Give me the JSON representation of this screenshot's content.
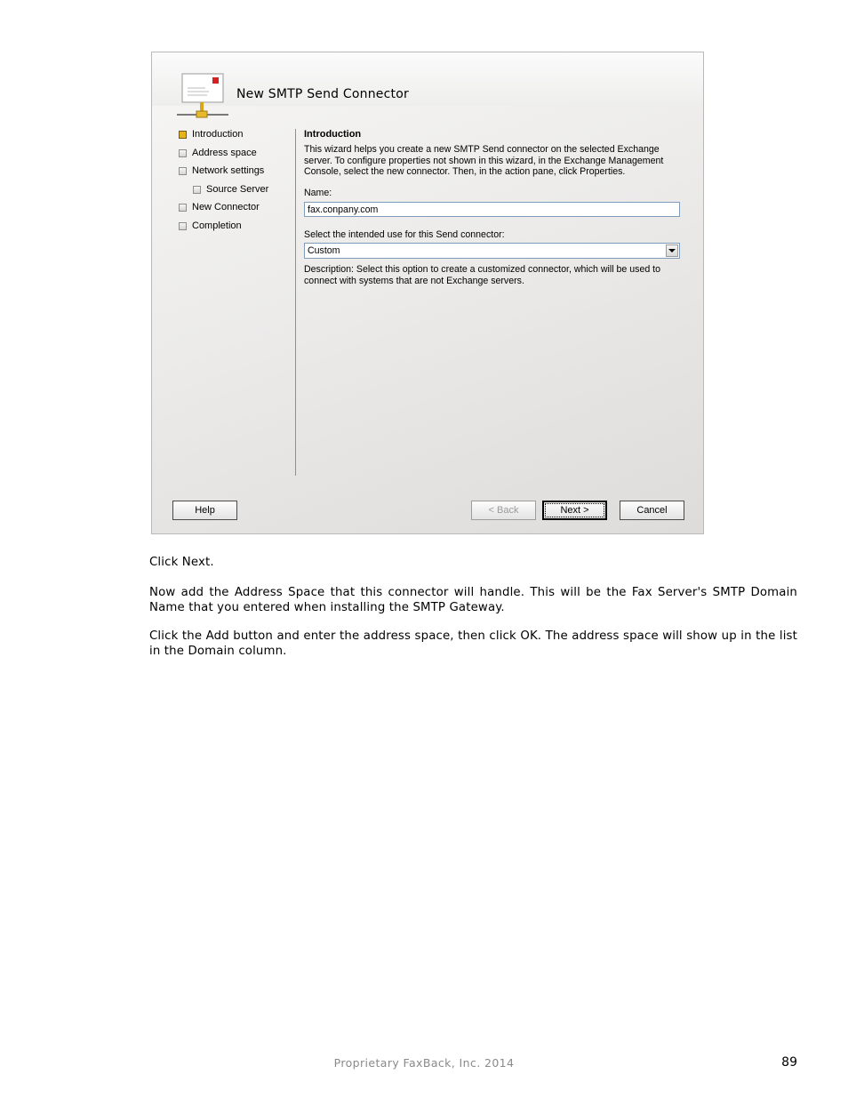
{
  "wizard": {
    "title": "New SMTP Send Connector",
    "steps": [
      {
        "label": "Introduction",
        "active": true
      },
      {
        "label": "Address space",
        "active": false
      },
      {
        "label": "Network settings",
        "active": false
      },
      {
        "label": "Source Server",
        "active": false
      },
      {
        "label": "New Connector",
        "active": false
      },
      {
        "label": "Completion",
        "active": false
      }
    ],
    "section_title": "Introduction",
    "intro_text": "This wizard helps you create a new SMTP Send connector on the selected Exchange server. To configure properties not shown in this wizard, in the Exchange Management Console, select the new connector. Then, in the action pane, click Properties.",
    "name_label": "Name:",
    "name_value": "fax.conpany.com",
    "use_label": "Select the intended use for this Send connector:",
    "use_value": "Custom",
    "description": "Description: Select this option to create a customized connector, which will be used to connect with systems that are not Exchange servers.",
    "buttons": {
      "help": "Help",
      "back": "< Back",
      "next": "Next >",
      "cancel": "Cancel"
    }
  },
  "document": {
    "para1": "Click Next.",
    "para2": "Now add the Address Space that this connector will handle. This will be the Fax Server's SMTP Domain Name that you entered when installing the SMTP Gateway.",
    "para3": "Click the Add button and enter the address space, then click OK. The address space will show up in the list in the Domain column."
  },
  "footer": {
    "text": "Proprietary FaxBack, Inc. 2014",
    "page_number": "89"
  }
}
